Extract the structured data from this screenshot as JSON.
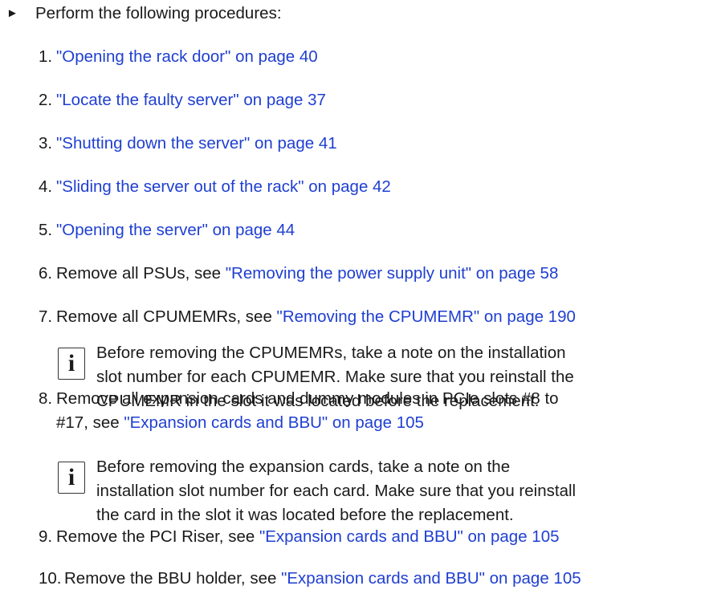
{
  "intro": {
    "text": "Perform the following procedures:"
  },
  "steps": [
    {
      "num": "1.",
      "text": "",
      "link": "\"Opening the rack door\" on page 40"
    },
    {
      "num": "2.",
      "text": "",
      "link": "\"Locate the faulty server\" on page 37"
    },
    {
      "num": "3.",
      "text": "",
      "link": "\"Shutting down the server\" on page 41"
    },
    {
      "num": "4.",
      "text": "",
      "link": "\"Sliding the server out of the rack\" on page 42"
    },
    {
      "num": "5.",
      "text": "",
      "link": "\"Opening the server\" on page 44"
    },
    {
      "num": "6.",
      "text": "Remove all PSUs, see ",
      "link": "\"Removing the power supply unit\" on page 58"
    },
    {
      "num": "7.",
      "text": "Remove all CPUMEMRs, see ",
      "link": "\"Removing the CPUMEMR\" on page 190"
    },
    {
      "num": "8.",
      "text": "Remove all expansion cards and dummy modules in PCIe slots #8 to",
      "text2": "#17, see ",
      "link": "\"Expansion cards and BBU\" on page 105"
    },
    {
      "num": "9.",
      "text": "Remove the PCI Riser, see ",
      "link": "\"Expansion cards and BBU\" on page 105"
    },
    {
      "num": "10.",
      "text": "Remove the BBU holder, see ",
      "link": "\"Expansion cards and BBU\" on page 105"
    }
  ],
  "notes": [
    {
      "icon": "i",
      "lines": [
        "Before removing the CPUMEMRs, take a note on the installation",
        "slot number for each CPUMEMR. Make sure that you reinstall the",
        "CPUMEMR in the slot it was located before the replacement."
      ]
    },
    {
      "icon": "i",
      "lines": [
        "Before removing the expansion cards, take a note on the",
        "installation slot number for each card. Make sure that you reinstall",
        "the card in the slot it was located before the replacement."
      ]
    }
  ],
  "colors": {
    "link": "#1f3fd1",
    "text": "#1a1a1a"
  },
  "icons": {
    "bullet": "triangle-right-icon",
    "note": "info-icon"
  }
}
